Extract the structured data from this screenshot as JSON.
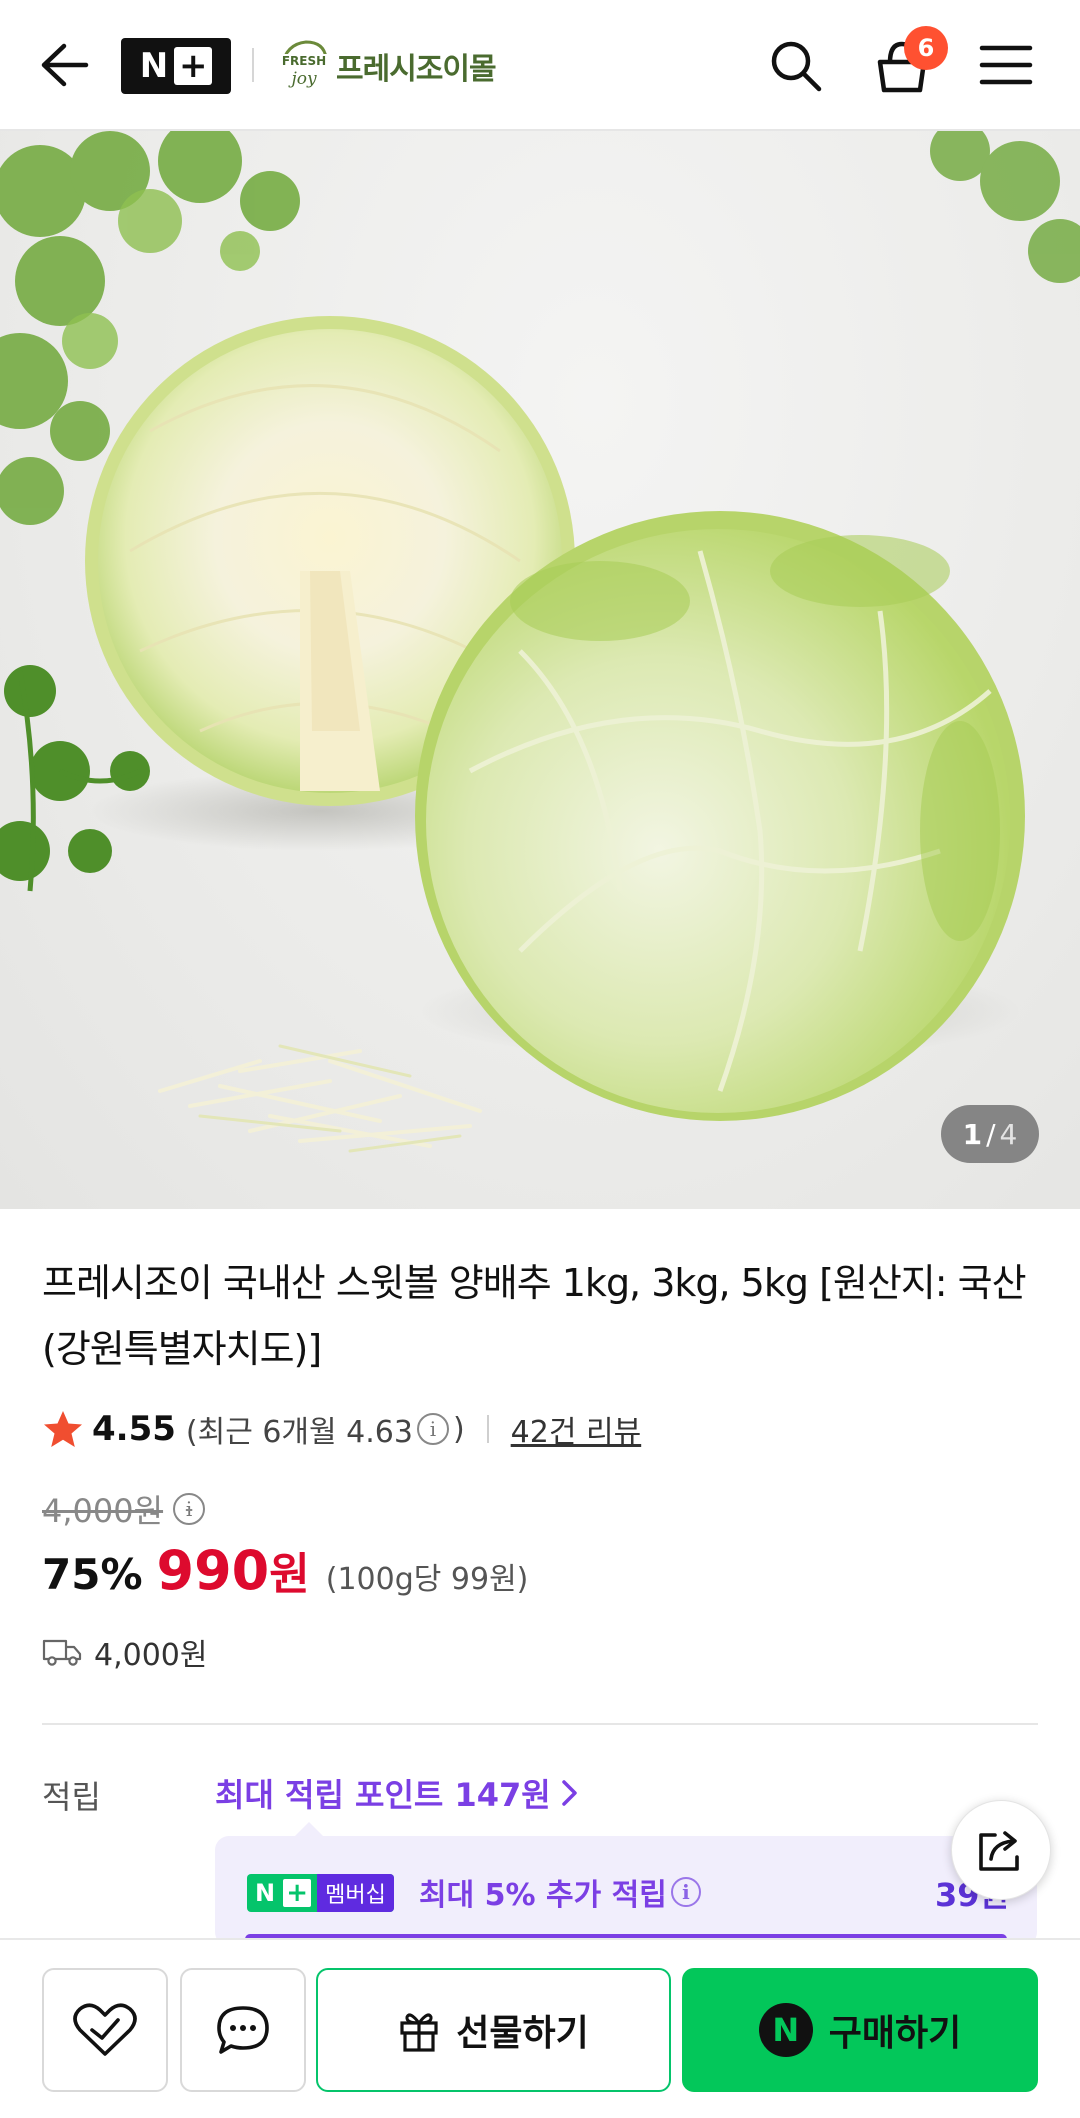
{
  "header": {
    "back_icon": "arrow-left-icon",
    "nplus_logo": {
      "n": "N",
      "plus": "+"
    },
    "brand_logo": "fresh-joy-logo",
    "store_name": "프레시조이몰",
    "search_icon": "search-icon",
    "cart_icon": "shopping-bag-icon",
    "cart_count": "6",
    "menu_icon": "hamburger-menu-icon"
  },
  "gallery": {
    "current": "1",
    "separator": "/",
    "total": "4"
  },
  "product": {
    "title": "프레시조이 국내산 스윗볼 양배추 1kg, 3kg, 5kg [원산지: 국산(강원특별자치도)]",
    "rating": "4.55",
    "recent_rating_prefix": "(최근 6개월 4.63",
    "recent_rating_suffix": ")",
    "review_count": "42건 리뷰",
    "original_price": "4,000원",
    "discount": "75%",
    "price": "990",
    "price_unit": "원",
    "unit_price": "(100g당 99원)",
    "shipping_fee": "4,000원"
  },
  "points": {
    "label": "적립",
    "max_points": "최대 적립 포인트 147원",
    "membership_badge_n": "N",
    "membership_badge_plus": "+",
    "membership_badge_label": "멤버십",
    "membership_text": "최대 5% 추가 적립",
    "membership_amount": "39원"
  },
  "bottom_bar": {
    "like_icon": "heart-check-icon",
    "talk_icon": "chat-bubble-icon",
    "share_icon": "share-icon",
    "gift_label": "선물하기",
    "gift_icon": "gift-icon",
    "buy_label": "구매하기",
    "buy_icon_letter": "N"
  },
  "colors": {
    "accent_green": "#03c75a",
    "price_red": "#dd0a2e",
    "points_purple": "#7b3fe4",
    "badge_orange": "#ff5131"
  }
}
